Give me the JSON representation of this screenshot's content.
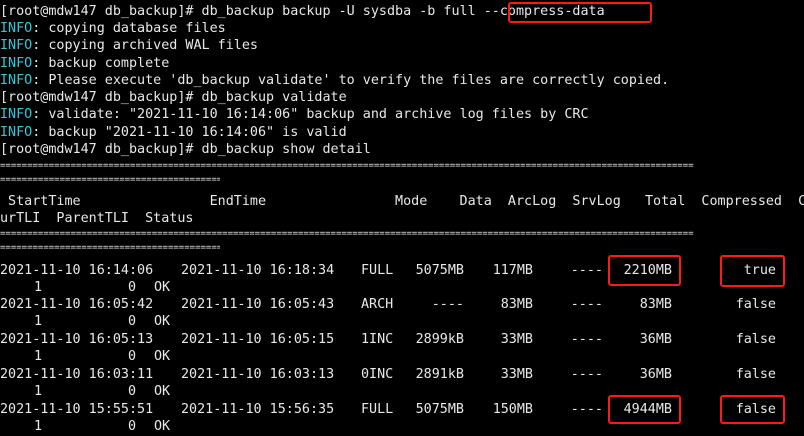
{
  "terminal": {
    "lines": [
      {
        "prompt": "[root@mdw147 db_backup]# ",
        "command": "db_backup backup -U sysdba -b full ",
        "command_highlight": "--compress-data"
      },
      {
        "level": "INFO",
        "text": ": copying database files"
      },
      {
        "level": "INFO",
        "text": ": copying archived WAL files"
      },
      {
        "level": "INFO",
        "text": ": backup complete"
      },
      {
        "level": "INFO",
        "text": ": Please execute 'db_backup validate' to verify the files are correctly copied."
      },
      {
        "prompt": "[root@mdw147 db_backup]# ",
        "command": "db_backup validate"
      },
      {
        "level": "INFO",
        "text": ": validate: \"2021-11-10 16:14:06\" backup and archive log files by CRC"
      },
      {
        "level": "INFO",
        "text": ": backup \"2021-11-10 16:14:06\" is valid"
      },
      {
        "prompt": "[root@mdw147 db_backup]# ",
        "command": "db_backup show detail"
      }
    ],
    "separator": "================================================================================================================================",
    "header_line_1": " StartTime                EndTime                Mode    Data  ArcLog  SrvLog   Total  Compressed  C",
    "header_line_2": "urTLI  ParentTLI  Status",
    "rows": [
      {
        "start": "2021-11-10 16:14:06",
        "end": "2021-11-10 16:18:34",
        "mode": "FULL",
        "data": "5075MB",
        "arclog": "117MB",
        "srvlog": "----",
        "total": "2210MB",
        "compressed": "true",
        "curtli": "1",
        "parenttli": "0",
        "status": "OK"
      },
      {
        "start": "2021-11-10 16:05:42",
        "end": "2021-11-10 16:05:43",
        "mode": "ARCH",
        "data": "----",
        "arclog": "83MB",
        "srvlog": "----",
        "total": "83MB",
        "compressed": "false",
        "curtli": "1",
        "parenttli": "0",
        "status": "OK"
      },
      {
        "start": "2021-11-10 16:05:13",
        "end": "2021-11-10 16:05:15",
        "mode": "1INC",
        "data": "2899kB",
        "arclog": "33MB",
        "srvlog": "----",
        "total": "36MB",
        "compressed": "false",
        "curtli": "1",
        "parenttli": "0",
        "status": "OK"
      },
      {
        "start": "2021-11-10 16:03:11",
        "end": "2021-11-10 16:03:13",
        "mode": "0INC",
        "data": "2891kB",
        "arclog": "33MB",
        "srvlog": "----",
        "total": "36MB",
        "compressed": "false",
        "curtli": "1",
        "parenttli": "0",
        "status": "OK"
      },
      {
        "start": "2021-11-10 15:55:51",
        "end": "2021-11-10 15:56:35",
        "mode": "FULL",
        "data": "5075MB",
        "arclog": "150MB",
        "srvlog": "----",
        "total": "4944MB",
        "compressed": "false",
        "curtli": "1",
        "parenttli": "0",
        "status": "OK"
      }
    ]
  },
  "colors": {
    "background": "#000000",
    "text": "#e8e8e8",
    "info": "#35c6d6",
    "highlight": "#ff1a1a"
  }
}
